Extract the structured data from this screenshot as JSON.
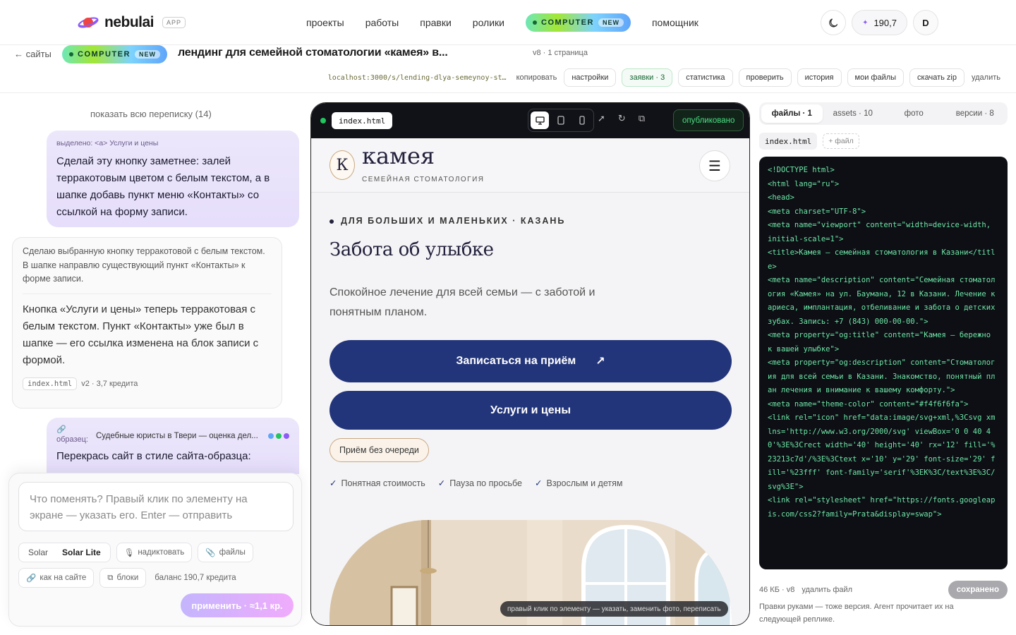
{
  "nav": {
    "brand": "nebulai",
    "app_badge": "APP",
    "menu": [
      "проекты",
      "работы",
      "правки",
      "ролики"
    ],
    "computer_label": "COMPUTER",
    "computer_new": "NEW",
    "assistant": "помощник",
    "balance": "190,7",
    "avatar": "D"
  },
  "subbar": {
    "back": "← сайты",
    "title": "лендинг для семейной стоматологии «камея» в...",
    "version": "v8 · 1 страница",
    "url": "localhost:3000/s/lending-dlya-semeynoy-st…",
    "copy": "копировать",
    "actions": [
      "настройки",
      "заявки · 3",
      "статистика",
      "проверить",
      "история",
      "мои файлы",
      "скачать zip"
    ],
    "delete": "удалить"
  },
  "chat": {
    "show_all": "показать всю переписку (14)",
    "user1": {
      "selected": "выделено: <a> Услуги и цены",
      "text": "Сделай эту кнопку заметнее: залей терракотовым цветом с белым текстом, а в шапке добавь пункт меню «Контакты» со ссылкой на форму записи."
    },
    "ai1": {
      "plan": "Сделаю выбранную кнопку терракотовой с белым текстом.\nВ шапке направлю существующий пункт «Контакты» к форме записи.",
      "result": "Кнопка «Услуги и цены» теперь терракотовая с белым текстом. Пункт «Контакты» уже был в шапке — его ссылка изменена на блок записи с формой.",
      "file": "index.html",
      "meta": "v2 · 3,7 кредита"
    },
    "user2": {
      "sample_label": "образец:",
      "sample_title": "Судебные юристы в Твери — оценка дел...",
      "text": "Перекрась сайт в стиле сайта-образца:"
    }
  },
  "composer": {
    "placeholder": "Что поменять? Правый клик по элементу на экране — указать его. Enter — отправить",
    "models": [
      "Solar",
      "Solar Lite"
    ],
    "dictate": "надиктовать",
    "files": "файлы",
    "like_site": "как на сайте",
    "blocks": "блоки",
    "balance": "баланс 190,7 кредита",
    "apply": "применить · ≈1,1 кр."
  },
  "preview": {
    "file": "index.html",
    "published": "опубликовано",
    "hint": "правый клик по элементу — указать, заменить фото, переписать",
    "site": {
      "logo_letter": "К",
      "name": "камея",
      "subtitle": "СЕМЕЙНАЯ СТОМАТОЛОГИЯ",
      "eyebrow": "ДЛЯ БОЛЬШИХ И МАЛЕНЬКИХ · КАЗАНЬ",
      "h1": "Забота об улыбке",
      "lead": "Спокойное лечение для всей семьи — с заботой и понятным планом.",
      "btn_book": "Записаться на приём",
      "btn_services": "Услуги и цены",
      "walk_in": "Приём без очереди",
      "checks": [
        "Понятная стоимость",
        "Пауза по просьбе",
        "Взрослым и детям"
      ]
    }
  },
  "panel": {
    "tabs": [
      "файлы · 1",
      "assets · 10",
      "фото",
      "версии · 8"
    ],
    "file_chip": "index.html",
    "add_file": "+ файл",
    "code": "<!DOCTYPE html>\n<html lang=\"ru\">\n<head>\n<meta charset=\"UTF-8\">\n<meta name=\"viewport\" content=\"width=device-width, initial-scale=1\">\n<title>Камея — семейная стоматология в Казани</title>\n<meta name=\"description\" content=\"Семейная стоматология «Камея» на ул. Баумана, 12 в Казани. Лечение кариеса, имплантация, отбеливание и забота о детских зубах. Запись: +7 (843) 000-00-00.\">\n<meta property=\"og:title\" content=\"Камея — бережно к вашей улыбке\">\n<meta property=\"og:description\" content=\"Стоматология для всей семьи в Казани. Знакомство, понятный план лечения и внимание к вашему комфорту.\">\n<meta name=\"theme-color\" content=\"#f4f6f6fa\">\n<link rel=\"icon\" href=\"data:image/svg+xml,%3Csvg xmlns='http://www.w3.org/2000/svg' viewBox='0 0 40 40'%3E%3Crect width='40' height='40' rx='12' fill='%23213c7d'/%3E%3Ctext x='10' y='29' font-size='29' fill='%23fff' font-family='serif'%3EК%3C/text%3E%3C/svg%3E\">\n<link rel=\"stylesheet\" href=\"https://fonts.googleapis.com/css2?family=Prata&display=swap\">",
    "size": "46 КБ · v8",
    "delete_file": "удалить файл",
    "saved": "сохранено",
    "note": "Правки руками — тоже версия. Агент прочитает их на следующей реплике."
  }
}
